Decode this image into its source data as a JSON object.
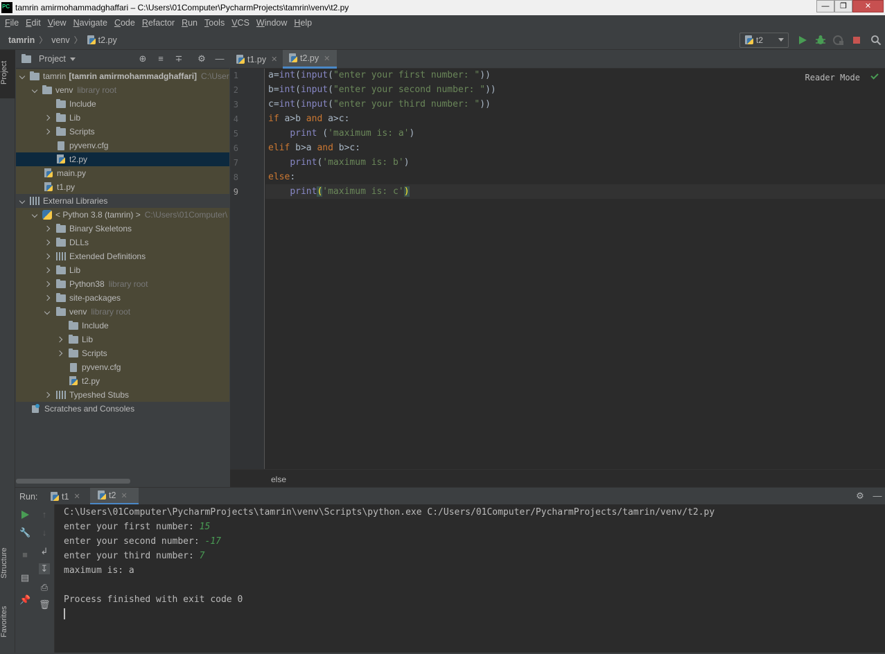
{
  "window": {
    "title": "tamrin amirmohammadghaffari – C:\\Users\\01Computer\\PycharmProjects\\tamrin\\venv\\t2.py"
  },
  "menu": [
    "File",
    "Edit",
    "View",
    "Navigate",
    "Code",
    "Refactor",
    "Run",
    "Tools",
    "VCS",
    "Window",
    "Help"
  ],
  "navbar": {
    "crumbs": [
      "tamrin",
      "venv",
      "t2.py"
    ],
    "run_config": "t2"
  },
  "left_stripe": {
    "project": "Project",
    "structure": "Structure",
    "favorites": "Favorites"
  },
  "project_panel": {
    "title": "Project",
    "tree": [
      {
        "label": "tamrin",
        "extra": "[tamrin amirmohammadghaffari]",
        "hint": "C:\\User"
      },
      {
        "label": "venv",
        "hint": "library root"
      },
      {
        "label": "Include"
      },
      {
        "label": "Lib"
      },
      {
        "label": "Scripts"
      },
      {
        "label": "pyvenv.cfg"
      },
      {
        "label": "t2.py"
      },
      {
        "label": "main.py"
      },
      {
        "label": "t1.py"
      },
      {
        "label": "External Libraries"
      },
      {
        "label": "< Python 3.8 (tamrin) >",
        "hint": "C:\\Users\\01Computer\\"
      },
      {
        "label": "Binary Skeletons"
      },
      {
        "label": "DLLs"
      },
      {
        "label": "Extended Definitions"
      },
      {
        "label": "Lib"
      },
      {
        "label": "Python38",
        "hint": "library root"
      },
      {
        "label": "site-packages"
      },
      {
        "label": "venv",
        "hint": "library root"
      },
      {
        "label": "Include"
      },
      {
        "label": "Lib"
      },
      {
        "label": "Scripts"
      },
      {
        "label": "pyvenv.cfg"
      },
      {
        "label": "t2.py"
      },
      {
        "label": "Typeshed Stubs"
      },
      {
        "label": "Scratches and Consoles"
      }
    ]
  },
  "editor": {
    "tabs": [
      "t1.py",
      "t2.py"
    ],
    "active_tab": "t2.py",
    "reader_mode": "Reader Mode",
    "line_numbers": [
      "1",
      "2",
      "3",
      "4",
      "5",
      "6",
      "7",
      "8",
      "9"
    ],
    "breadcrumb": "else",
    "code": [
      "a=int(input(\"enter your first number: \"))",
      "b=int(input(\"enter your second number: \"))",
      "c=int(input(\"enter your third number: \"))",
      "if a>b and a>c:",
      "    print ('maximum is: a')",
      "elif b>a and b>c:",
      "    print('maximum is: b')",
      "else:",
      "    print('maximum is: c')"
    ]
  },
  "run_panel": {
    "label": "Run:",
    "tabs": [
      "t1",
      "t2"
    ],
    "active_tab": "t2",
    "console": {
      "command": "C:\\Users\\01Computer\\PycharmProjects\\tamrin\\venv\\Scripts\\python.exe C:/Users/01Computer/PycharmProjects/tamrin/venv/t2.py",
      "prompts": [
        {
          "prompt": "enter your first number: ",
          "value": "15"
        },
        {
          "prompt": "enter your second number: ",
          "value": "-17"
        },
        {
          "prompt": "enter your third number: ",
          "value": "7"
        }
      ],
      "result": "maximum is: a",
      "exit": "Process finished with exit code 0"
    }
  },
  "colors": {
    "keyword": "#cc7832",
    "string": "#6a8759",
    "builtin": "#8888c6",
    "input": "#499c54",
    "run": "#499c54",
    "stop": "#c75450",
    "selection": "#0d293e"
  }
}
